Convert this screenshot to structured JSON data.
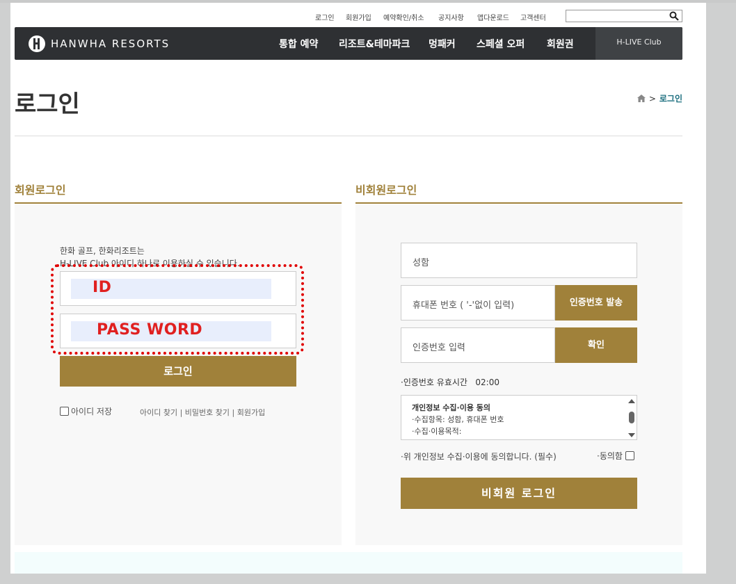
{
  "util": {
    "links": [
      "로그인",
      "회원가입",
      "예약확인/취소",
      "공지사항",
      "앱다운로드",
      "고객센터"
    ],
    "search_placeholder": ""
  },
  "nav": {
    "brand": "HANWHA RESORTS",
    "menu": [
      "통합 예약",
      "리조트&테마파크",
      "멍패커",
      "스페셜 오퍼",
      "회원권"
    ],
    "club": "H-LIVE Club"
  },
  "page": {
    "title": "로그인",
    "breadcrumb_current": "로그인"
  },
  "member": {
    "section_title": "회원로그인",
    "desc_line1": "한화 골프, 한화리조트는",
    "desc_line2": "H-LIVE Club 아이디 하나로 이용하실 수 있습니다.",
    "id_label": "ID",
    "password_label": "PASS WORD",
    "login_button": "로그인",
    "remember_label": "아이디 저장",
    "links": "아이디 찾기 | 비밀번호 찾기 | 회원가입"
  },
  "nonmember": {
    "section_title": "비회원로그인",
    "name_placeholder": "성함",
    "phone_placeholder": "휴대폰 번호 ( '-'없이 입력)",
    "send_code_button": "인증번호 발송",
    "code_placeholder": "인증번호 입력",
    "confirm_button": "확인",
    "valid_time_label": "·인증번호 유효시간",
    "valid_time_value": "02:00",
    "terms_title": "개인정보 수집·이용 동의",
    "terms_line1": "·수집항목: 성함, 휴대폰 번호",
    "terms_line2": "·수집·이용목적:",
    "agree_text": "·위 개인정보 수집·이용에 동의합니다. (필수)",
    "agree_label": "·동의함",
    "login_button": "비회원 로그인"
  },
  "colors": {
    "accent": "#a0813a",
    "nav_bg": "#2e3033",
    "highlight_border": "#e00000"
  }
}
